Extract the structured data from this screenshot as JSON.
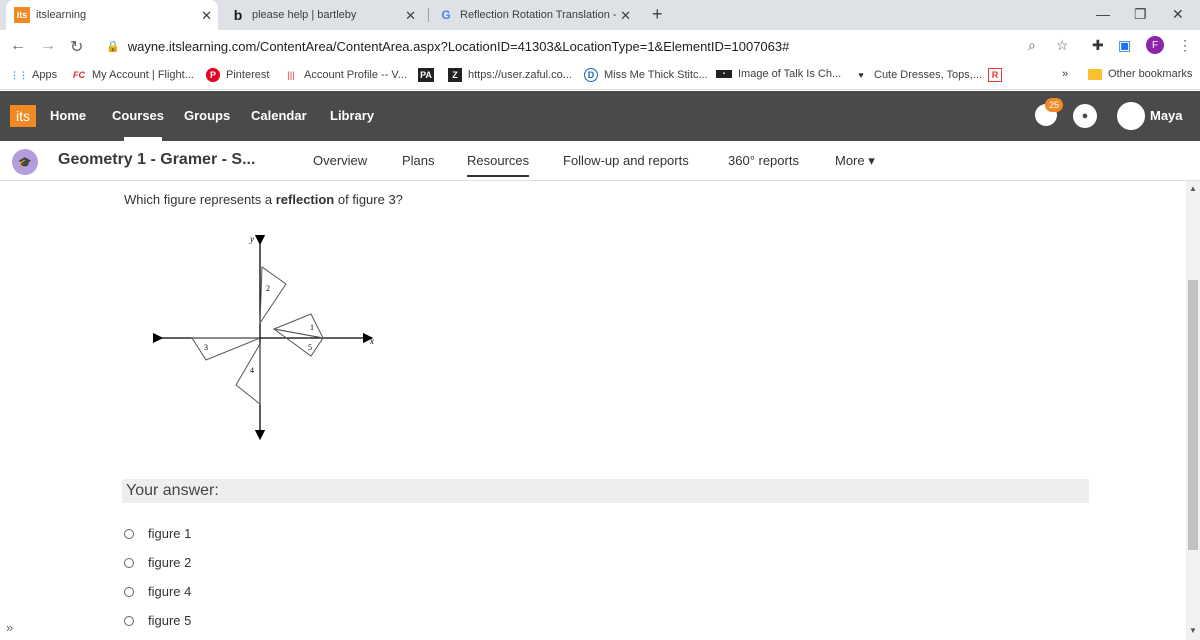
{
  "browser": {
    "tabs": [
      {
        "label": "itslearning",
        "icon": "its"
      },
      {
        "label": "please help | bartleby",
        "icon": "b"
      },
      {
        "label": "Reflection Rotation Translation -",
        "icon": "G"
      }
    ],
    "url": "wayne.itslearning.com/ContentArea/ContentArea.aspx?LocationID=41303&LocationType=1&ElementID=1007063#",
    "profile_initial": "F",
    "bookmarks": [
      {
        "label": "Apps",
        "icon": "⋮⋮"
      },
      {
        "label": "My Account | Flight...",
        "icon": "FC"
      },
      {
        "label": "Pinterest",
        "icon": "P"
      },
      {
        "label": "Account Profile -- V...",
        "icon": "|||"
      },
      {
        "label": "",
        "icon": "PA"
      },
      {
        "label": "https://user.zaful.co...",
        "icon": "Z"
      },
      {
        "label": "Miss Me Thick Stitc...",
        "icon": "D"
      },
      {
        "label": "Image of Talk Is Ch...",
        "icon": "▪"
      },
      {
        "label": "Cute Dresses, Tops,...",
        "icon": "♥"
      },
      {
        "label": "",
        "icon": "R"
      }
    ],
    "more_bookmarks": "»",
    "other_bookmarks": "Other bookmarks"
  },
  "app": {
    "logo": "its",
    "nav": [
      "Home",
      "Courses",
      "Groups",
      "Calendar",
      "Library"
    ],
    "notification_count": "25",
    "user": "Maya"
  },
  "course": {
    "title": "Geometry 1 - Gramer - S...",
    "tabs": [
      "Overview",
      "Plans",
      "Resources",
      "Follow-up and reports",
      "360° reports",
      "More ▾"
    ],
    "active_tab": "Resources"
  },
  "question": {
    "prefix": "Which figure represents a ",
    "bold": "reflection",
    "suffix": " of figure 3?",
    "figure_labels": {
      "y": "y",
      "x": "x",
      "f1": "1",
      "f2": "2",
      "f3": "3",
      "f4": "4",
      "f5": "5"
    },
    "answer_label": "Your answer:",
    "options": [
      "figure 1",
      "figure 2",
      "figure 4",
      "figure 5"
    ]
  }
}
